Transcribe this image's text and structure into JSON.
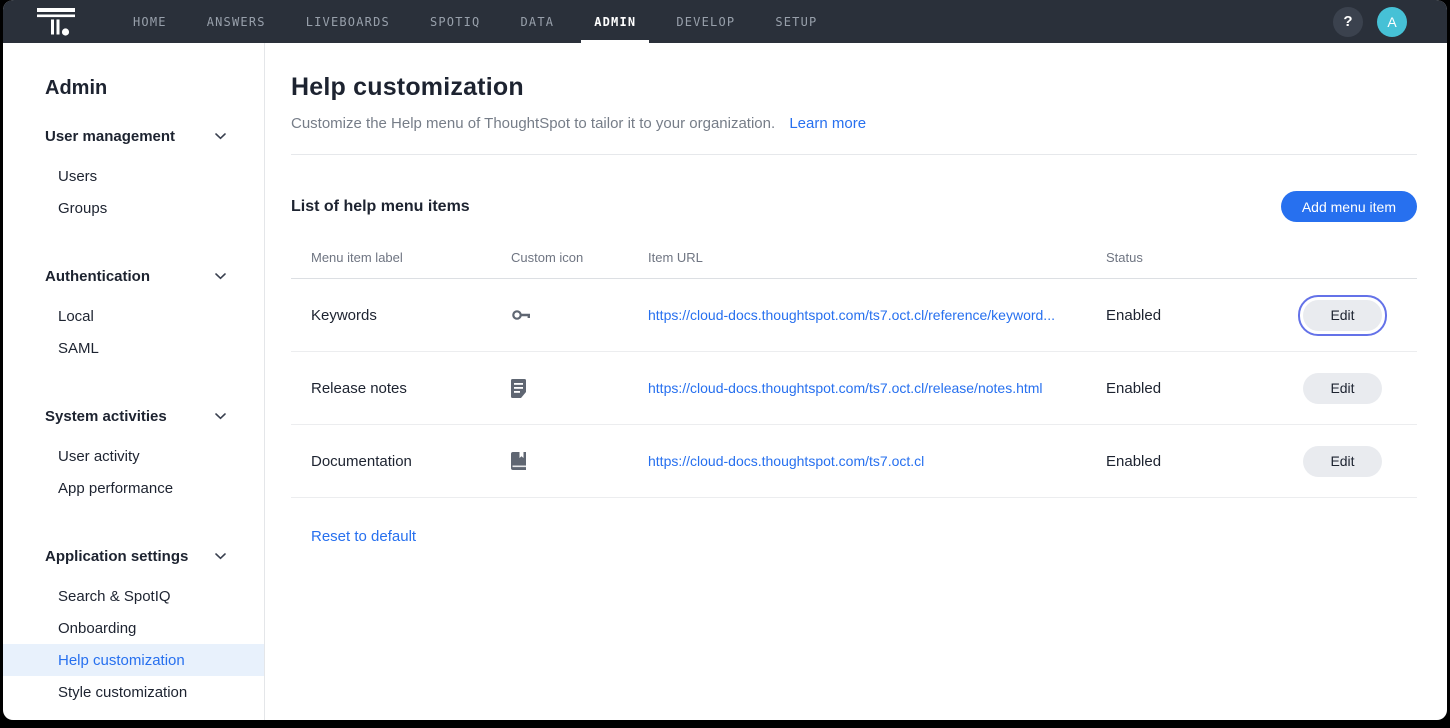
{
  "nav": {
    "items": [
      "HOME",
      "ANSWERS",
      "LIVEBOARDS",
      "SPOTIQ",
      "DATA",
      "ADMIN",
      "DEVELOP",
      "SETUP"
    ],
    "active": "ADMIN",
    "help_button": "?",
    "avatar": "A"
  },
  "sidebar": {
    "title": "Admin",
    "sections": [
      {
        "label": "User management",
        "items": [
          "Users",
          "Groups"
        ]
      },
      {
        "label": "Authentication",
        "items": [
          "Local",
          "SAML"
        ]
      },
      {
        "label": "System activities",
        "items": [
          "User activity",
          "App performance"
        ]
      },
      {
        "label": "Application settings",
        "items": [
          "Search & SpotIQ",
          "Onboarding",
          "Help customization",
          "Style customization"
        ]
      }
    ],
    "selected_item": "Help customization"
  },
  "main": {
    "title": "Help customization",
    "subtitle": "Customize the Help menu of ThoughtSpot to tailor it to your organization.",
    "learn_more": "Learn more",
    "list": {
      "title": "List of help menu items",
      "add_button": "Add menu item",
      "headers": [
        "Menu item label",
        "Custom icon",
        "Item URL",
        "Status"
      ],
      "rows": [
        {
          "label": "Keywords",
          "icon": "key-icon",
          "url": "https://cloud-docs.thoughtspot.com/ts7.oct.cl/reference/keyword...",
          "status": "Enabled",
          "action": "Edit",
          "focused": true
        },
        {
          "label": "Release notes",
          "icon": "release-notes-icon",
          "url": "https://cloud-docs.thoughtspot.com/ts7.oct.cl/release/notes.html",
          "status": "Enabled",
          "action": "Edit",
          "focused": false
        },
        {
          "label": "Documentation",
          "icon": "book-icon",
          "url": "https://cloud-docs.thoughtspot.com/ts7.oct.cl",
          "status": "Enabled",
          "action": "Edit",
          "focused": false
        }
      ]
    },
    "reset_link": "Reset to default"
  },
  "colors": {
    "accent_blue": "#2770EF",
    "nav_bg": "#2A303A",
    "avatar_teal": "#46C1D6",
    "selected_bg": "#E8F1FC",
    "focus_ring": "#6472E8",
    "icon_gray": "#5F6672"
  }
}
